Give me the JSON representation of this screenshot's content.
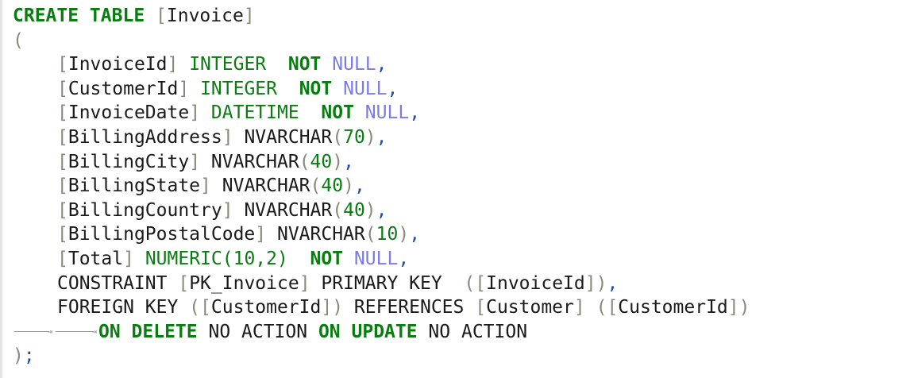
{
  "lines": [
    {
      "parts": [
        {
          "c": "kw-bold",
          "t": "CREATE TABLE"
        },
        {
          "c": "plain",
          "t": " "
        },
        {
          "c": "brk",
          "t": "["
        },
        {
          "c": "ident",
          "t": "Invoice"
        },
        {
          "c": "brk",
          "t": "]"
        }
      ]
    },
    {
      "parts": [
        {
          "c": "brk",
          "t": "("
        }
      ]
    },
    {
      "indent": true,
      "parts": [
        {
          "c": "brk",
          "t": "["
        },
        {
          "c": "ident",
          "t": "InvoiceId"
        },
        {
          "c": "brk",
          "t": "]"
        },
        {
          "c": "plain",
          "t": " "
        },
        {
          "c": "kw",
          "t": "INTEGER"
        },
        {
          "c": "plain",
          "t": "  "
        },
        {
          "c": "kw-bold",
          "t": "NOT"
        },
        {
          "c": "plain",
          "t": " "
        },
        {
          "c": "null",
          "t": "NULL"
        },
        {
          "c": "comma",
          "t": ","
        }
      ]
    },
    {
      "indent": true,
      "parts": [
        {
          "c": "brk",
          "t": "["
        },
        {
          "c": "ident",
          "t": "CustomerId"
        },
        {
          "c": "brk",
          "t": "]"
        },
        {
          "c": "plain",
          "t": " "
        },
        {
          "c": "kw",
          "t": "INTEGER"
        },
        {
          "c": "plain",
          "t": "  "
        },
        {
          "c": "kw-bold",
          "t": "NOT"
        },
        {
          "c": "plain",
          "t": " "
        },
        {
          "c": "null",
          "t": "NULL"
        },
        {
          "c": "comma",
          "t": ","
        }
      ]
    },
    {
      "indent": true,
      "parts": [
        {
          "c": "brk",
          "t": "["
        },
        {
          "c": "ident",
          "t": "InvoiceDate"
        },
        {
          "c": "brk",
          "t": "]"
        },
        {
          "c": "plain",
          "t": " "
        },
        {
          "c": "kw",
          "t": "DATETIME"
        },
        {
          "c": "plain",
          "t": "  "
        },
        {
          "c": "kw-bold",
          "t": "NOT"
        },
        {
          "c": "plain",
          "t": " "
        },
        {
          "c": "null",
          "t": "NULL"
        },
        {
          "c": "comma",
          "t": ","
        }
      ]
    },
    {
      "indent": true,
      "parts": [
        {
          "c": "brk",
          "t": "["
        },
        {
          "c": "ident",
          "t": "BillingAddress"
        },
        {
          "c": "brk",
          "t": "]"
        },
        {
          "c": "plain",
          "t": " "
        },
        {
          "c": "plain",
          "t": "NVARCHAR"
        },
        {
          "c": "brk",
          "t": "("
        },
        {
          "c": "num",
          "t": "70"
        },
        {
          "c": "brk",
          "t": ")"
        },
        {
          "c": "comma",
          "t": ","
        }
      ]
    },
    {
      "indent": true,
      "parts": [
        {
          "c": "brk",
          "t": "["
        },
        {
          "c": "ident",
          "t": "BillingCity"
        },
        {
          "c": "brk",
          "t": "]"
        },
        {
          "c": "plain",
          "t": " "
        },
        {
          "c": "plain",
          "t": "NVARCHAR"
        },
        {
          "c": "brk",
          "t": "("
        },
        {
          "c": "num",
          "t": "40"
        },
        {
          "c": "brk",
          "t": ")"
        },
        {
          "c": "comma",
          "t": ","
        }
      ]
    },
    {
      "indent": true,
      "parts": [
        {
          "c": "brk",
          "t": "["
        },
        {
          "c": "ident",
          "t": "BillingState"
        },
        {
          "c": "brk",
          "t": "]"
        },
        {
          "c": "plain",
          "t": " "
        },
        {
          "c": "plain",
          "t": "NVARCHAR"
        },
        {
          "c": "brk",
          "t": "("
        },
        {
          "c": "num",
          "t": "40"
        },
        {
          "c": "brk",
          "t": ")"
        },
        {
          "c": "comma",
          "t": ","
        }
      ]
    },
    {
      "indent": true,
      "parts": [
        {
          "c": "brk",
          "t": "["
        },
        {
          "c": "ident",
          "t": "BillingCountry"
        },
        {
          "c": "brk",
          "t": "]"
        },
        {
          "c": "plain",
          "t": " "
        },
        {
          "c": "plain",
          "t": "NVARCHAR"
        },
        {
          "c": "brk",
          "t": "("
        },
        {
          "c": "num",
          "t": "40"
        },
        {
          "c": "brk",
          "t": ")"
        },
        {
          "c": "comma",
          "t": ","
        }
      ]
    },
    {
      "indent": true,
      "parts": [
        {
          "c": "brk",
          "t": "["
        },
        {
          "c": "ident",
          "t": "BillingPostalCode"
        },
        {
          "c": "brk",
          "t": "]"
        },
        {
          "c": "plain",
          "t": " "
        },
        {
          "c": "plain",
          "t": "NVARCHAR"
        },
        {
          "c": "brk",
          "t": "("
        },
        {
          "c": "num",
          "t": "10"
        },
        {
          "c": "brk",
          "t": ")"
        },
        {
          "c": "comma",
          "t": ","
        }
      ]
    },
    {
      "indent": true,
      "parts": [
        {
          "c": "brk",
          "t": "["
        },
        {
          "c": "ident",
          "t": "Total"
        },
        {
          "c": "brk",
          "t": "]"
        },
        {
          "c": "plain",
          "t": " "
        },
        {
          "c": "kw",
          "t": "NUMERIC(10,2)"
        },
        {
          "c": "plain",
          "t": "  "
        },
        {
          "c": "kw-bold",
          "t": "NOT"
        },
        {
          "c": "plain",
          "t": " "
        },
        {
          "c": "null",
          "t": "NULL"
        },
        {
          "c": "comma",
          "t": ","
        }
      ]
    },
    {
      "indent": true,
      "parts": [
        {
          "c": "plain",
          "t": "CONSTRAINT"
        },
        {
          "c": "plain",
          "t": " "
        },
        {
          "c": "brk",
          "t": "["
        },
        {
          "c": "ident",
          "t": "PK_Invoice"
        },
        {
          "c": "brk",
          "t": "]"
        },
        {
          "c": "plain",
          "t": " PRIMARY KEY  "
        },
        {
          "c": "brk",
          "t": "(["
        },
        {
          "c": "ident",
          "t": "InvoiceId"
        },
        {
          "c": "brk",
          "t": "])"
        },
        {
          "c": "comma",
          "t": ","
        }
      ]
    },
    {
      "indent": true,
      "parts": [
        {
          "c": "plain",
          "t": "FOREIGN KEY "
        },
        {
          "c": "brk",
          "t": "(["
        },
        {
          "c": "ident",
          "t": "CustomerId"
        },
        {
          "c": "brk",
          "t": "])"
        },
        {
          "c": "plain",
          "t": " REFERENCES "
        },
        {
          "c": "brk",
          "t": "["
        },
        {
          "c": "ident",
          "t": "Customer"
        },
        {
          "c": "brk",
          "t": "]"
        },
        {
          "c": "plain",
          "t": " "
        },
        {
          "c": "brk",
          "t": "(["
        },
        {
          "c": "ident",
          "t": "CustomerId"
        },
        {
          "c": "brk",
          "t": "])"
        }
      ]
    },
    {
      "tabs": 2,
      "parts": [
        {
          "c": "kw-bold",
          "t": "ON DELETE"
        },
        {
          "c": "plain",
          "t": " NO ACTION "
        },
        {
          "c": "kw-bold",
          "t": "ON UPDATE"
        },
        {
          "c": "plain",
          "t": " NO ACTION"
        }
      ]
    },
    {
      "parts": [
        {
          "c": "brk",
          "t": ")"
        },
        {
          "c": "comma",
          "t": ";"
        }
      ]
    }
  ]
}
